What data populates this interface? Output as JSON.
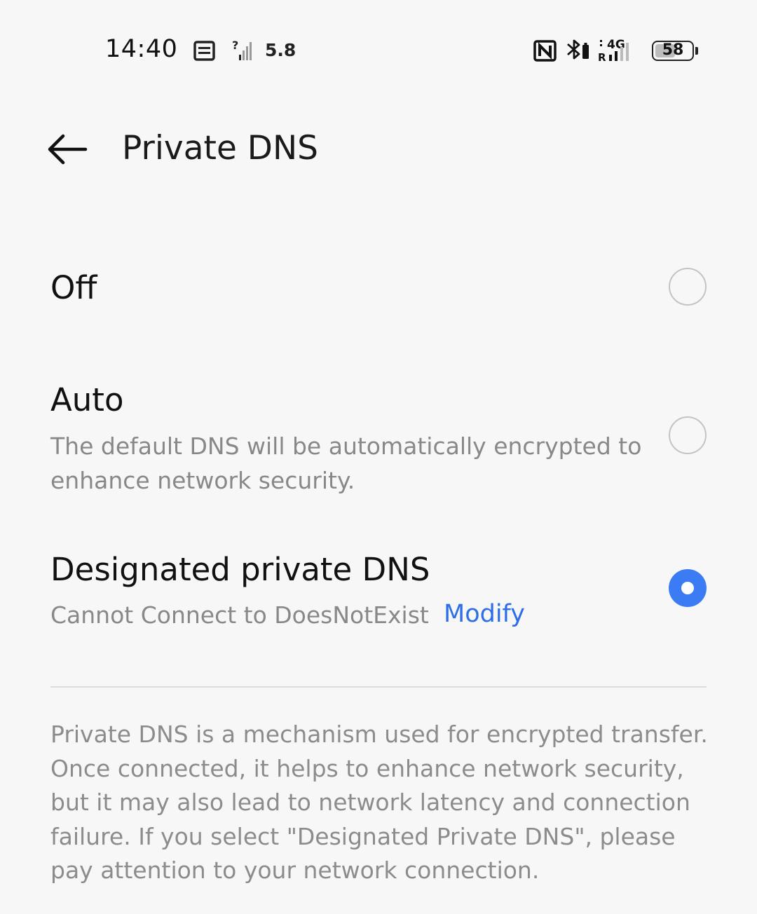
{
  "status_bar": {
    "time": "14:40",
    "net_speed": "5.8",
    "battery_level": "58",
    "battery_fraction": 0.58,
    "network_type": "4G",
    "roaming_label": "R",
    "no_sim_mark": "?",
    "icons": [
      "notification-list-icon",
      "no-signal-icon",
      "nfc-icon",
      "bluetooth-icon",
      "cellular-4g-icon",
      "battery-icon"
    ]
  },
  "header": {
    "back_icon": "back-arrow-icon",
    "title": "Private DNS"
  },
  "options": [
    {
      "title": "Off",
      "description": "",
      "selected": false
    },
    {
      "title": "Auto",
      "description": "The default DNS will be automatically encrypted to enhance network security.",
      "selected": false
    },
    {
      "title": "Designated private DNS",
      "status": "Cannot Connect to DoesNotExist",
      "action_label": "Modify",
      "selected": true
    }
  ],
  "footer_note": "Private DNS is a mechanism used for encrypted transfer. Once connected, it helps to enhance network security, but it may also lead to network latency and connection failure. If you select \"Designated Private DNS\", please pay attention to your network connection.",
  "colors": {
    "accent": "#3b7cf4",
    "link": "#2e6ee6",
    "background": "#f7f7f7",
    "secondary_text": "#888888"
  }
}
